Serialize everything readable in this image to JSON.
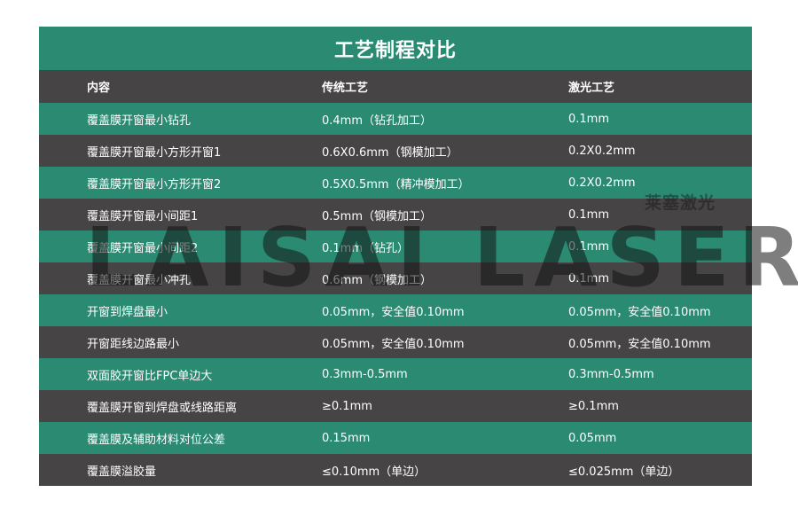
{
  "title": "工艺制程对比",
  "headers": [
    "内容",
    "传统工艺",
    "激光工艺"
  ],
  "rows": [
    [
      "覆盖膜开窗最小钻孔",
      "0.4mm（钻孔加工）",
      "0.1mm"
    ],
    [
      "覆盖膜开窗最小方形开窗1",
      "0.6X0.6mm（钢模加工）",
      "0.2X0.2mm"
    ],
    [
      "覆盖膜开窗最小方形开窗2",
      "0.5X0.5mm（精冲模加工）",
      "0.2X0.2mm"
    ],
    [
      "覆盖膜开窗最小间距1",
      "0.5mm（钢模加工）",
      "0.1mm"
    ],
    [
      "覆盖膜开窗最小间距2",
      "0.1mm（钻孔）",
      "0.1mm"
    ],
    [
      "覆盖膜开窗最小冲孔",
      "0.6mm（钢模加工）",
      "0.1mm"
    ],
    [
      "开窗到焊盘最小",
      "0.05mm，安全值0.10mm",
      "0.05mm，安全值0.10mm"
    ],
    [
      "开窗距线边路最小",
      "0.05mm，安全值0.10mm",
      "0.05mm，安全值0.10mm"
    ],
    [
      "双面胶开窗比FPC单边大",
      "0.3mm-0.5mm",
      "0.3mm-0.5mm"
    ],
    [
      "覆盖膜开窗到焊盘或线路距离",
      "≥0.1mm",
      "≥0.1mm"
    ],
    [
      "覆盖膜及辅助材料对位公差",
      "0.15mm",
      "0.05mm"
    ],
    [
      "覆盖膜溢胶量",
      "≤0.10mm（单边）",
      "≤0.025mm（单边）"
    ]
  ],
  "watermark": "LAISAI LASER",
  "watermark_cn": "莱塞激光",
  "colors": {
    "green": "#2b8a72",
    "dark": "#464445",
    "text": "#ffffff"
  }
}
